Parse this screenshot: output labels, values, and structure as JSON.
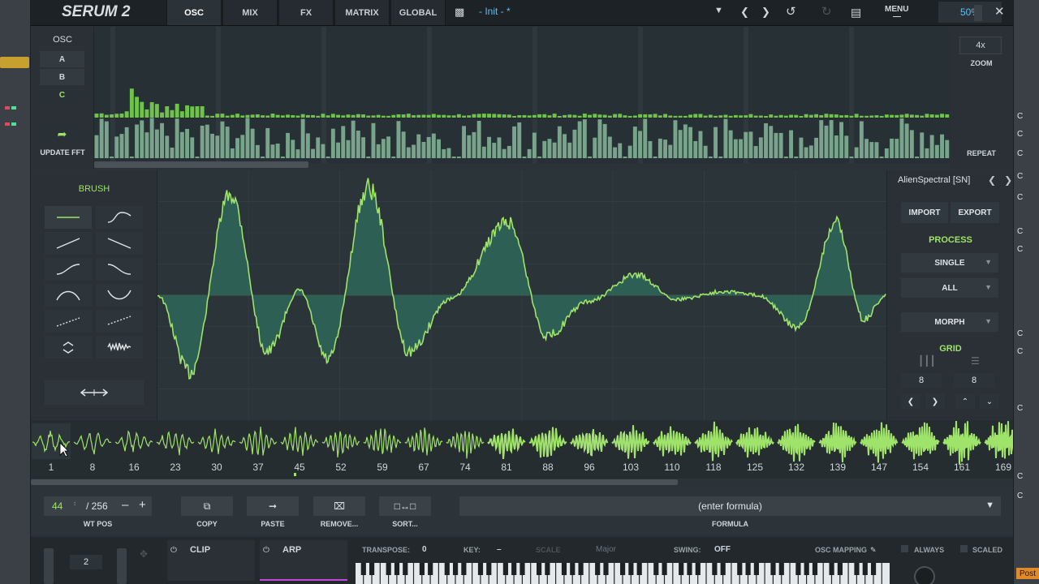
{
  "topbar": {
    "logo": "SERUM 2",
    "tabs": [
      "OSC",
      "MIX",
      "FX",
      "MATRIX",
      "GLOBAL"
    ],
    "active_tab": "OSC",
    "preset_name": "- Init -  *",
    "menu_label": "MENU",
    "zoom_percent": "50%"
  },
  "osc": {
    "label": "OSC",
    "buttons": [
      "A",
      "B",
      "C"
    ],
    "active": "C",
    "update_fft_label": "UPDATE FFT"
  },
  "spectrum_side": {
    "zoom_value": "4x",
    "zoom_label": "ZOOM",
    "repeat_label": "REPEAT"
  },
  "brush": {
    "label": "BRUSH",
    "tools": [
      "flat",
      "s-curve",
      "ramp-up",
      "ramp-down",
      "ease-up",
      "ease-down",
      "arch",
      "valley",
      "dotted-up",
      "dotted-down",
      "expand",
      "noise"
    ]
  },
  "process": {
    "wavetable_name": "AlienSpectral [SN]",
    "import_label": "IMPORT",
    "export_label": "EXPORT",
    "process_label": "PROCESS",
    "single_label": "SINGLE",
    "all_label": "ALL",
    "morph_label": "MORPH",
    "grid_label": "GRID",
    "grid_x": "8",
    "grid_y": "8"
  },
  "thumbnails": [
    "1",
    "8",
    "16",
    "23",
    "30",
    "37",
    "45",
    "52",
    "59",
    "67",
    "74",
    "81",
    "88",
    "96",
    "103",
    "110",
    "118",
    "125",
    "132",
    "139",
    "147",
    "154",
    "161",
    "169"
  ],
  "bottom": {
    "wt_pos_value": "44",
    "wt_pos_total": "/ 256",
    "wt_pos_label": "WT POS",
    "copy_label": "COPY",
    "paste_label": "PASTE",
    "remove_label": "REMOVE...",
    "sort_label": "SORT...",
    "formula_placeholder": "(enter formula)",
    "formula_label": "FORMULA"
  },
  "lower": {
    "voices": "2",
    "clip_label": "CLIP",
    "arp_label": "ARP",
    "transpose_label": "TRANSPOSE:",
    "transpose_value": "0",
    "key_label": "KEY:",
    "key_value": "–",
    "scale_label": "SCALE",
    "scale_value": "Major",
    "swing_label": "SWING:",
    "swing_value": "OFF",
    "osc_mapping_label": "OSC MAPPING",
    "always_label": "ALWAYS",
    "scaled_label": "SCALED"
  },
  "host": {
    "right_letters": [
      "C",
      "C",
      "C",
      "C",
      "C",
      "C",
      "C",
      "C",
      "C",
      "C",
      "C",
      "C"
    ],
    "post_label": "Post"
  },
  "colors": {
    "accent_green": "#9fe36a",
    "accent_blue": "#5ec0f0",
    "bg_dark": "#1d2226"
  }
}
